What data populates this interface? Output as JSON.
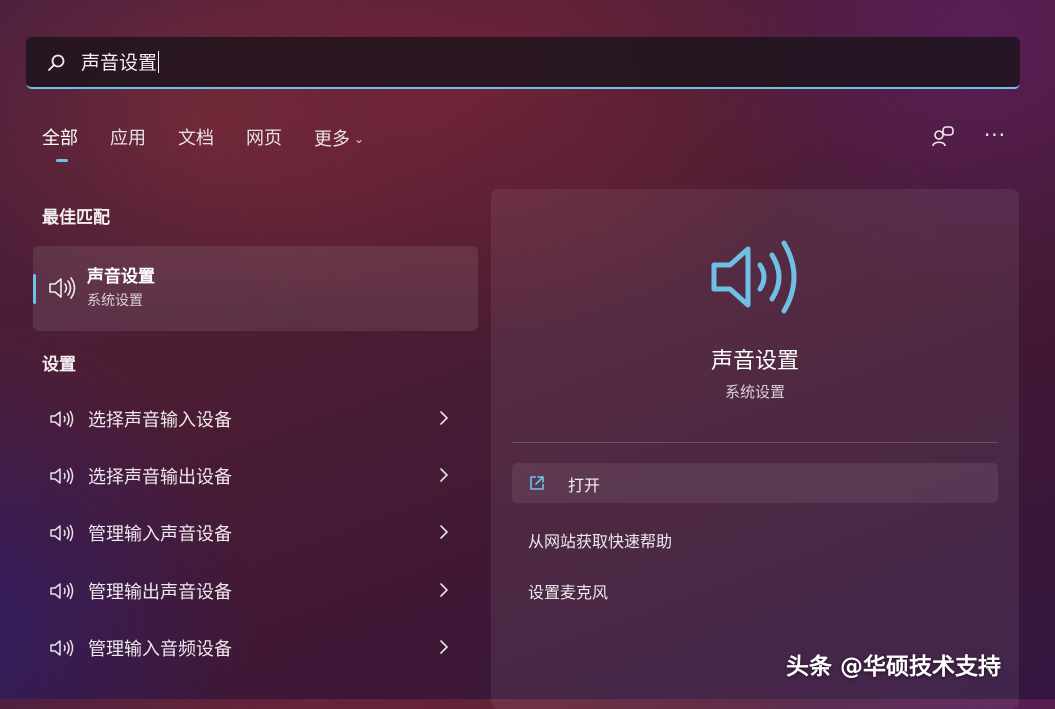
{
  "search": {
    "query": "声音设置",
    "icon": "search-icon"
  },
  "tabs": [
    {
      "label": "全部",
      "active": true
    },
    {
      "label": "应用"
    },
    {
      "label": "文档"
    },
    {
      "label": "网页"
    },
    {
      "label": "更多"
    }
  ],
  "toolbar": {
    "account_icon": "account-switch-icon",
    "more_icon": "more-options-icon"
  },
  "best_match": {
    "heading": "最佳匹配",
    "title": "声音设置",
    "subtitle": "系统设置",
    "icon": "speaker-icon"
  },
  "settings": {
    "heading": "设置",
    "items": [
      {
        "label": "选择声音输入设备"
      },
      {
        "label": "选择声音输出设备"
      },
      {
        "label": "管理输入声音设备"
      },
      {
        "label": "管理输出声音设备"
      },
      {
        "label": "管理输入音频设备"
      }
    ]
  },
  "detail": {
    "title": "声音设置",
    "subtitle": "系统设置",
    "open_label": "打开",
    "actions": [
      "从网站获取快速帮助",
      "设置麦克风"
    ]
  },
  "watermark": "头条 @华硕技术支持",
  "colors": {
    "accent": "#6fc0e6",
    "background": "#4a1f3f"
  }
}
